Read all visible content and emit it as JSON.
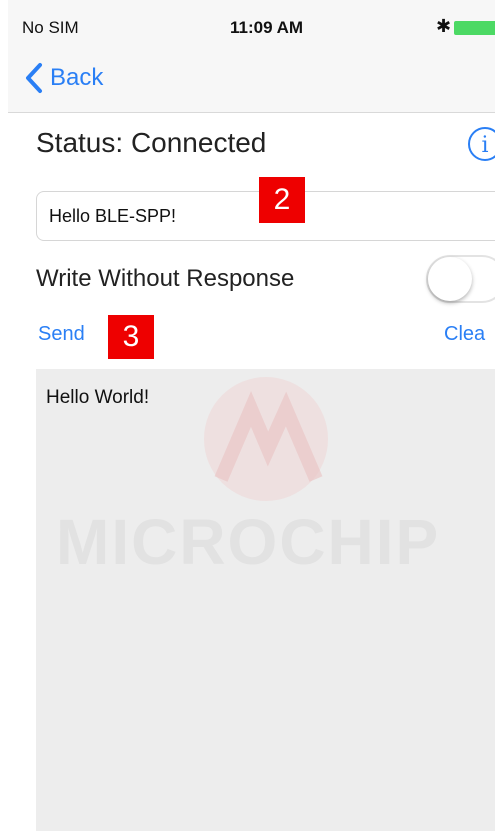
{
  "status_bar": {
    "carrier": "No SIM",
    "time": "11:09 AM",
    "bluetooth_icon": "bluetooth-icon",
    "battery_icon": "battery-icon"
  },
  "nav": {
    "back_label": "Back",
    "back_icon": "chevron-left-icon"
  },
  "main": {
    "status_text": "Status: Connected",
    "info_icon_glyph": "i",
    "message_value": "Hello BLE-SPP!",
    "write_without_response_label": "Write Without Response",
    "write_without_response_on": false,
    "send_label": "Send",
    "clear_label": "Clea",
    "output_text": "Hello World!",
    "watermark_text": "MICROCHIP"
  },
  "annotations": {
    "callout_2": "2",
    "callout_3": "3"
  },
  "colors": {
    "accent": "#2a7ff5",
    "callout": "#ee0000",
    "battery": "#4cd964"
  }
}
